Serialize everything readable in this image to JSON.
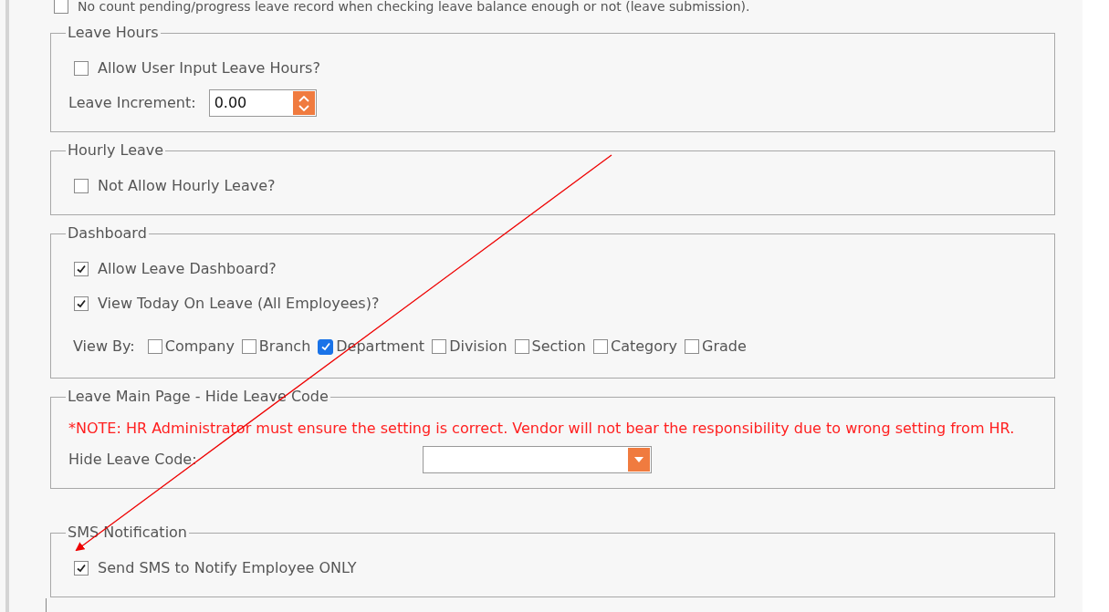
{
  "top_option": {
    "label": "No count pending/progress leave record when checking leave balance enough or not (leave submission).",
    "checked": false
  },
  "sections": [
    {
      "title": "Leave Hours",
      "rows": [
        {
          "kind": "checkbox",
          "label": "Allow User Input Leave Hours?",
          "checked": false
        },
        {
          "kind": "spinner",
          "label": "Leave Increment:",
          "value": "0.00"
        }
      ]
    },
    {
      "title": "Hourly Leave",
      "rows": [
        {
          "kind": "checkbox",
          "label": "Not Allow Hourly Leave?",
          "checked": false
        }
      ]
    },
    {
      "title": "Dashboard",
      "rows": [
        {
          "kind": "checkbox",
          "label": "Allow Leave Dashboard?",
          "checked": true
        },
        {
          "kind": "checkbox",
          "label": "View Today On Leave (All Employees)?",
          "checked": true
        },
        {
          "kind": "checkgroup",
          "label": "View By:",
          "options": [
            {
              "label": "Company",
              "checked": false
            },
            {
              "label": "Branch",
              "checked": false
            },
            {
              "label": "Department",
              "checked": true
            },
            {
              "label": "Division",
              "checked": false
            },
            {
              "label": "Section",
              "checked": false
            },
            {
              "label": "Category",
              "checked": false
            },
            {
              "label": "Grade",
              "checked": false
            }
          ]
        }
      ]
    },
    {
      "title": "Leave Main Page - Hide Leave Code",
      "rows": [
        {
          "kind": "note",
          "text": "*NOTE: HR Administrator must ensure the setting is correct. Vendor will not bear the responsibility due to wrong setting from HR."
        },
        {
          "kind": "dropdown",
          "label": "Hide Leave Code:"
        }
      ]
    },
    {
      "title": "SMS Notification",
      "rows": [
        {
          "kind": "checkbox",
          "label": "Send SMS to Notify Employee ONLY",
          "checked": true
        }
      ]
    }
  ]
}
